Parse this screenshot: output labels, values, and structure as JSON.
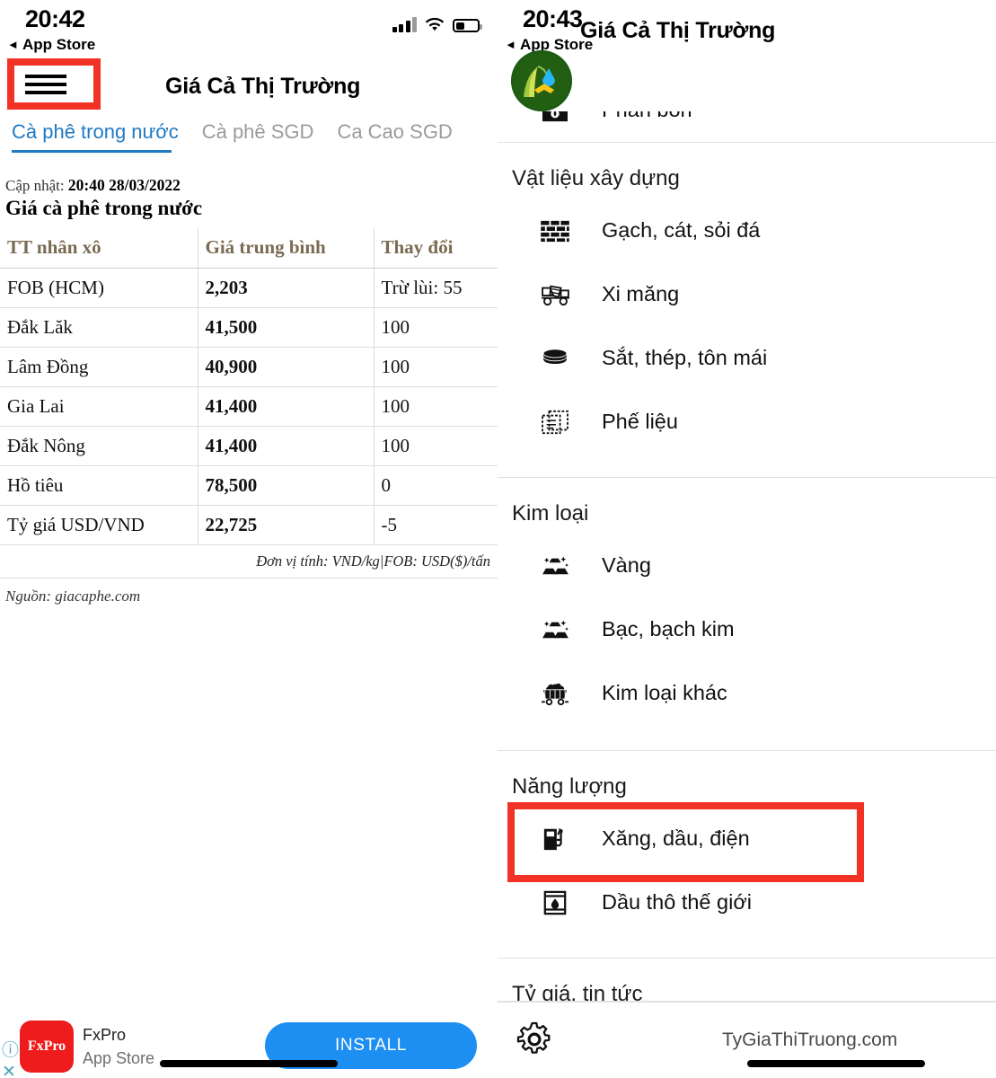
{
  "left_phone": {
    "status": {
      "time": "20:42",
      "back_label": "App Store",
      "signal_icon": "cellular-bars-icon",
      "wifi_icon": "wifi-icon",
      "battery_icon": "battery-low-icon"
    },
    "appbar": {
      "menu_icon": "hamburger-menu-icon",
      "title": "Giá Cả Thị Trường"
    },
    "tabs": [
      {
        "label": "Cà phê trong nước",
        "active": true
      },
      {
        "label": "Cà phê SGD",
        "active": false
      },
      {
        "label": "Ca Cao SGD",
        "active": false
      }
    ],
    "content": {
      "updated_prefix": "Cập nhật:",
      "updated_value": "20:40 28/03/2022",
      "section_title": "Giá cà phê trong nước",
      "unit_note": "Đơn vị tính: VND/kg|FOB: USD($)/tấn",
      "source_note": "Nguồn: giacaphe.com"
    },
    "ad": {
      "info_icon": "info-icon",
      "close_icon": "close-icon",
      "icon_text": "FxPro",
      "name": "FxPro",
      "subtitle": "App Store",
      "cta_label": "INSTALL"
    }
  },
  "chart_data": {
    "type": "table",
    "title": "Giá cà phê trong nước",
    "columns": [
      "TT nhân xô",
      "Giá trung bình",
      "Thay đổi"
    ],
    "rows": [
      [
        "FOB (HCM)",
        "2,203",
        "Trừ lùi: 55"
      ],
      [
        "Đắk Lăk",
        "41,500",
        "100"
      ],
      [
        "Lâm Đồng",
        "40,900",
        "100"
      ],
      [
        "Gia Lai",
        "41,400",
        "100"
      ],
      [
        "Đắk Nông",
        "41,400",
        "100"
      ],
      [
        "Hồ tiêu",
        "78,500",
        "0"
      ],
      [
        "Tỷ giá USD/VND",
        "22,725",
        "-5"
      ]
    ],
    "footnote": "Đơn vị tính: VND/kg|FOB: USD($)/tấn",
    "source": "Nguồn: giacaphe.com",
    "updated": "20:40 28/03/2022"
  },
  "right_phone": {
    "status": {
      "time": "20:43",
      "back_label": "App Store",
      "signal_icon": "cellular-bars-icon",
      "wifi_icon": "wifi-icon",
      "battery_icon": "battery-low-icon"
    },
    "appbar": {
      "logo_icon": "app-logo-icon",
      "title": "Giá Cả Thị Trường"
    },
    "drawer": {
      "clipped_item": {
        "icon": "fertilizer-icon",
        "label": "Phân bón"
      },
      "groups": [
        {
          "title": "Vật liệu xây dựng",
          "items": [
            {
              "icon": "brick-wall-icon",
              "label": "Gạch, cát, sỏi đá"
            },
            {
              "icon": "cement-truck-icon",
              "label": "Xi măng"
            },
            {
              "icon": "steel-coil-icon",
              "label": "Sắt, thép, tôn mái"
            },
            {
              "icon": "scrap-material-icon",
              "label": "Phế liệu"
            }
          ]
        },
        {
          "title": "Kim loại",
          "items": [
            {
              "icon": "gold-bars-icon",
              "label": "Vàng"
            },
            {
              "icon": "silver-bars-icon",
              "label": "Bạc, bạch kim"
            },
            {
              "icon": "ore-cart-icon",
              "label": "Kim loại khác"
            }
          ]
        },
        {
          "title": "Năng lượng",
          "items": [
            {
              "icon": "fuel-pump-icon",
              "label": "Xăng, dầu, điện",
              "highlighted": true
            },
            {
              "icon": "oil-barrel-icon",
              "label": "Dầu thô thế giới"
            }
          ]
        },
        {
          "title": "Tỷ giá, tin tức",
          "items": []
        }
      ],
      "footer": {
        "settings_icon": "gear-icon",
        "site_label": "TyGiaThiTruong.com"
      }
    }
  },
  "colors": {
    "accent_blue": "#1f7ac4",
    "highlight_red": "#f33226",
    "install_blue": "#1d8ef2",
    "logo_green": "#1d5c14",
    "ad_red": "#ee1c1c",
    "table_header": "#7a6a52"
  }
}
